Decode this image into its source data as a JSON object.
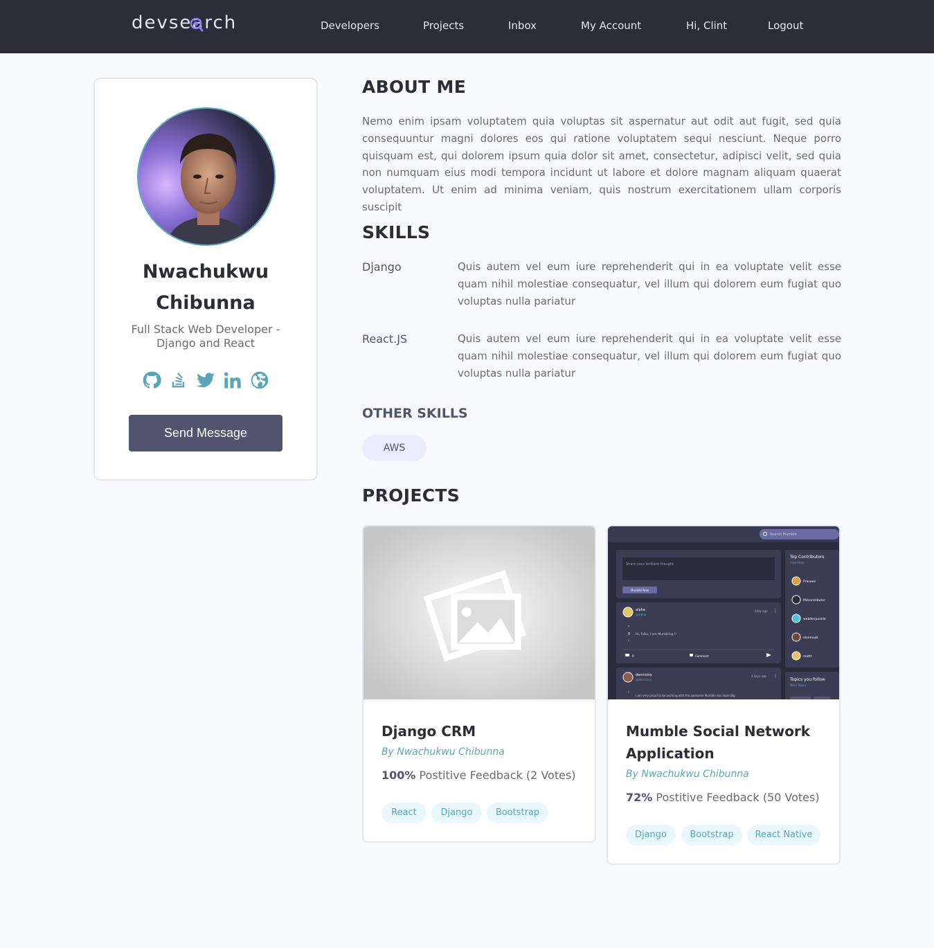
{
  "header": {
    "logo_text_start": "devse",
    "logo_text_o": "a",
    "logo_text_end": "rch",
    "nav": [
      "Developers",
      "Projects",
      "Inbox",
      "My Account",
      "Hi, Clint",
      "Logout"
    ]
  },
  "profile": {
    "name_line1": "Nwachukwu",
    "name_line2": "Chibunna",
    "role_line1": "Full Stack Web Developer -",
    "role_line2": "Django and React",
    "socials": [
      "github-icon",
      "stackoverflow-icon",
      "twitter-icon",
      "linkedin-icon",
      "globe-icon"
    ],
    "send_label": "Send Message"
  },
  "about": {
    "title": "ABOUT ME",
    "text": "Nemo enim ipsam voluptatem quia voluptas sit aspernatur aut odit aut fugit, sed quia consequuntur magni dolores eos qui ratione voluptatem sequi nesciunt. Neque porro quisquam est, qui dolorem ipsum quia dolor sit amet, consectetur, adipisci velit, sed quia non numquam eius modi tempora incidunt ut labore et dolore magnam aliquam quaerat voluptatem. Ut enim ad minima veniam, quis nostrum exercitationem ullam corporis suscipit"
  },
  "skills": {
    "title": "SKILLS",
    "items": [
      {
        "name": "Django",
        "desc": "Quis autem vel eum iure reprehenderit qui in ea voluptate velit esse quam nihil molestiae consequatur, vel illum qui dolorem eum fugiat quo voluptas nulla pariatur"
      },
      {
        "name": "React.JS",
        "desc": "Quis autem vel eum iure reprehenderit qui in ea voluptate velit esse quam nihil molestiae consequatur, vel illum qui dolorem eum fugiat quo voluptas nulla pariatur"
      }
    ]
  },
  "other_skills": {
    "title": "OTHER SKILLS",
    "items": [
      "AWS"
    ]
  },
  "projects": {
    "title": "PROJECTS",
    "items": [
      {
        "title": "Django CRM",
        "by": "By Nwachukwu Chibunna",
        "feedback_pct": "100%",
        "feedback_rest": " Postitive Feedback (2 Votes)",
        "tags": [
          "React",
          "Django",
          "Bootstrap"
        ]
      },
      {
        "title": "Mumble Social Network Application",
        "by": "By Nwachukwu Chibunna",
        "feedback_pct": "72%",
        "feedback_rest": " Postitive Feedback (50 Votes)",
        "tags": [
          "Django",
          "Bootstrap",
          "React Native"
        ]
      }
    ]
  },
  "mumble_preview": {
    "search_placeholder": "Search Mumble",
    "share_placeholder": "Share your brilliant thought",
    "mumble_btn": "Mumble Now",
    "top_contributors": "Top Contributors",
    "view_more": "View More",
    "contributors": [
      "Praveen",
      "Mdcontributor",
      "webdevjuniele",
      "elonmusk",
      "mattt"
    ],
    "post1_user": "alpha",
    "post1_handle": "@alpha",
    "post1_time": "1day ago",
    "post1_text": "Hi, folks, I am Mumbling !!",
    "post1_votes": "0",
    "post1_comments": "9",
    "post1_comment_label": "Comment",
    "post2_user": "dennisivy",
    "post2_handle": "@dennisivy",
    "post2_time": "2 days ago",
    "post2_text": "I am very proud to be working with the awesome Mumble dev team Big",
    "topics_title": "Topics you follow",
    "more_topics": "More Topics"
  },
  "colors": {
    "header_bg": "#2d2d39",
    "accent": "#51546e",
    "link": "#5aa5b9",
    "page_bg": "#f8faff"
  }
}
